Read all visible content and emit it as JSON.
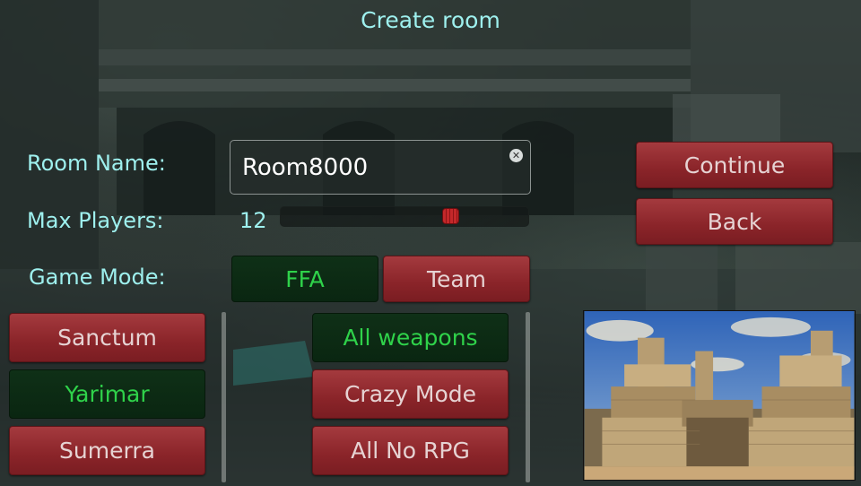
{
  "title": "Create room",
  "labels": {
    "room_name": "Room Name:",
    "max_players": "Max Players:",
    "game_mode": "Game Mode:"
  },
  "room_name_value": "Room8000",
  "max_players_value": "12",
  "max_players_slider_fraction": 0.7,
  "game_mode": {
    "options": [
      "FFA",
      "Team"
    ],
    "selected": "FFA"
  },
  "actions": {
    "continue": "Continue",
    "back": "Back"
  },
  "maps": {
    "items": [
      "Sanctum",
      "Yarimar",
      "Sumerra"
    ],
    "selected": "Yarimar"
  },
  "modes": {
    "items": [
      "All weapons",
      "Crazy Mode",
      "All No RPG"
    ],
    "selected": "All weapons"
  },
  "icons": {
    "clear": "clear-x-icon"
  },
  "colors": {
    "label_cyan": "#9ef0ee",
    "button_red": "#8a2429",
    "button_green_bg": "#0a2611",
    "button_green_text": "#2fd24a"
  }
}
